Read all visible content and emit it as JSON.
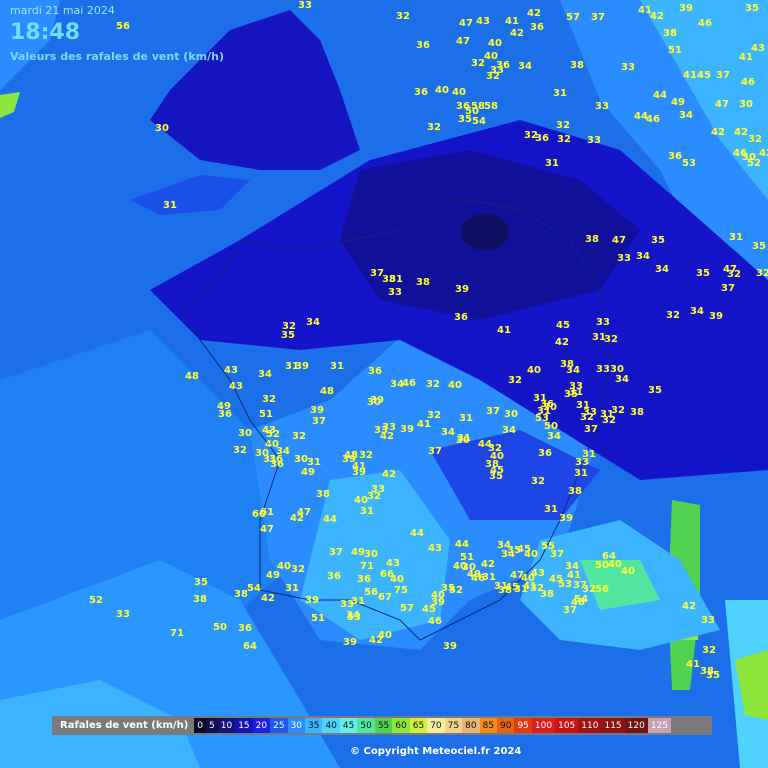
{
  "header": {
    "date": "mardi 21 mai 2024",
    "time": "18:48",
    "subtitle": "Valeurs des rafales de vent (km/h)"
  },
  "legend": {
    "title": "Rafales de vent (km/h)",
    "steps": [
      {
        "v": "0",
        "c": "#0a0a2a"
      },
      {
        "v": "5",
        "c": "#101050"
      },
      {
        "v": "10",
        "c": "#141478"
      },
      {
        "v": "15",
        "c": "#1414b4"
      },
      {
        "v": "20",
        "c": "#1e1ee6"
      },
      {
        "v": "25",
        "c": "#1e5af0"
      },
      {
        "v": "30",
        "c": "#2a8cff"
      },
      {
        "v": "35",
        "c": "#3cb4ff"
      },
      {
        "v": "40",
        "c": "#50d2ff"
      },
      {
        "v": "45",
        "c": "#64f0e6"
      },
      {
        "v": "50",
        "c": "#50e6a0"
      },
      {
        "v": "55",
        "c": "#50d250"
      },
      {
        "v": "60",
        "c": "#8ce63c"
      },
      {
        "v": "65",
        "c": "#d2f03c"
      },
      {
        "v": "70",
        "c": "#f0f0a0"
      },
      {
        "v": "75",
        "c": "#f0d28c"
      },
      {
        "v": "80",
        "c": "#e6b478"
      },
      {
        "v": "85",
        "c": "#f08c1e"
      },
      {
        "v": "90",
        "c": "#e66414"
      },
      {
        "v": "95",
        "c": "#dc3c14"
      },
      {
        "v": "100",
        "c": "#dc1e1e"
      },
      {
        "v": "105",
        "c": "#c81414"
      },
      {
        "v": "110",
        "c": "#a01414"
      },
      {
        "v": "115",
        "c": "#8c1414"
      },
      {
        "v": "120",
        "c": "#6e1414"
      },
      {
        "v": "125",
        "c": "#c8a0b4"
      }
    ]
  },
  "copyright": "© Copyright Meteociel.fr 2024",
  "station_values": [
    "56",
    "33",
    "32",
    "47",
    "43",
    "41",
    "42",
    "37",
    "41",
    "39",
    "46",
    "35",
    "47",
    "40",
    "42",
    "57",
    "36",
    "36",
    "40",
    "40",
    "36",
    "35",
    "32",
    "36",
    "34",
    "38",
    "42",
    "32",
    "32",
    "36",
    "33",
    "38",
    "51",
    "41",
    "45",
    "47",
    "37",
    "46",
    "41",
    "43",
    "58",
    "40",
    "33",
    "31",
    "32",
    "58",
    "33",
    "44",
    "49",
    "34",
    "44",
    "30",
    "42",
    "30",
    "32",
    "50",
    "54",
    "36",
    "46",
    "32",
    "33",
    "42",
    "46",
    "42",
    "52",
    "30",
    "31",
    "36",
    "53",
    "32",
    "31",
    "47",
    "35",
    "38",
    "34",
    "33",
    "34",
    "35",
    "31",
    "35",
    "32",
    "47",
    "32",
    "37",
    "37",
    "38",
    "31",
    "33",
    "38",
    "39",
    "41",
    "36",
    "42",
    "45",
    "31",
    "33",
    "32",
    "32",
    "34",
    "39",
    "33",
    "30",
    "34",
    "35",
    "38",
    "34",
    "33",
    "40",
    "32",
    "31",
    "30",
    "31",
    "32",
    "32",
    "38",
    "32",
    "37",
    "36",
    "53",
    "50",
    "30",
    "31",
    "31",
    "31",
    "33",
    "35",
    "37",
    "34",
    "34",
    "36",
    "33",
    "31",
    "31",
    "32",
    "38",
    "39",
    "31",
    "35",
    "45",
    "32",
    "44",
    "40",
    "38",
    "30",
    "31",
    "34",
    "31",
    "32",
    "37",
    "41",
    "39",
    "33",
    "33",
    "42",
    "39",
    "36",
    "46",
    "34",
    "32",
    "40",
    "30",
    "37",
    "39",
    "48",
    "31",
    "39",
    "31",
    "34",
    "35",
    "32",
    "43",
    "43",
    "49",
    "34",
    "32",
    "51",
    "30",
    "43",
    "52",
    "40",
    "36",
    "34",
    "32",
    "30",
    "31",
    "36",
    "32",
    "48",
    "36",
    "30",
    "31",
    "49",
    "39",
    "41",
    "32",
    "39",
    "48",
    "42",
    "33",
    "32",
    "40",
    "31",
    "38",
    "44",
    "47",
    "42",
    "61",
    "60",
    "47",
    "44",
    "43",
    "44",
    "51",
    "40",
    "30",
    "42",
    "34",
    "35",
    "45",
    "34",
    "40",
    "55",
    "37",
    "34",
    "31",
    "47",
    "40",
    "43",
    "45",
    "53",
    "37",
    "41",
    "50",
    "64",
    "40",
    "56",
    "32",
    "54",
    "48",
    "37",
    "38",
    "32",
    "31",
    "41",
    "45",
    "38",
    "49",
    "46",
    "52",
    "35",
    "40",
    "39",
    "45",
    "57",
    "75",
    "40",
    "67",
    "66",
    "71",
    "36",
    "56",
    "31",
    "33",
    "34",
    "36",
    "37",
    "49",
    "30",
    "43",
    "32",
    "40",
    "49",
    "31",
    "39",
    "51",
    "42",
    "38",
    "54",
    "35",
    "38",
    "52",
    "33",
    "71",
    "50",
    "36",
    "64",
    "53",
    "39",
    "42",
    "40",
    "46",
    "39",
    "31",
    "42",
    "33",
    "32",
    "41",
    "38",
    "35",
    "40"
  ]
}
